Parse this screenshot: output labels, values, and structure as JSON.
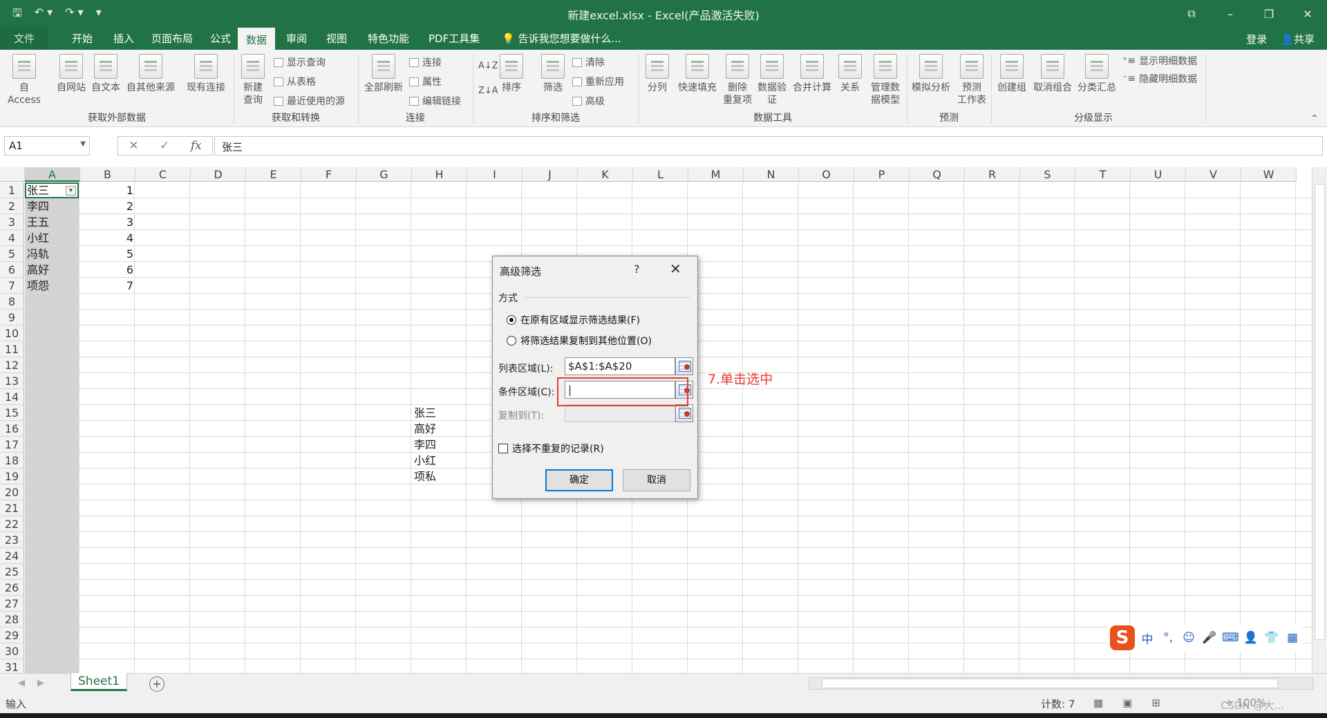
{
  "window": {
    "title": "新建excel.xlsx - Excel(产品激活失败)",
    "qat": [
      "save-icon",
      "undo-icon",
      "redo-icon",
      "customize-icon"
    ],
    "controls": [
      "⧉",
      "–",
      "❐",
      "✕"
    ]
  },
  "tabs": {
    "file": "文件",
    "items": [
      "开始",
      "插入",
      "页面布局",
      "公式",
      "数据",
      "审阅",
      "视图",
      "特色功能",
      "PDF工具集"
    ],
    "active": "数据",
    "tell_me": "告诉我您想要做什么...",
    "login": "登录",
    "share": "共享"
  },
  "ribbon": {
    "get_external": {
      "buttons": [
        "自 Access",
        "自网站",
        "自文本",
        "自其他来源",
        "现有连接"
      ],
      "label": "获取外部数据"
    },
    "get_transform": {
      "new_query": "新建\n查询",
      "small": [
        "显示查询",
        "从表格",
        "最近使用的源"
      ],
      "label": "获取和转换"
    },
    "connections": {
      "refresh_all": "全部刷新",
      "small": [
        "连接",
        "属性",
        "编辑链接"
      ],
      "label": "连接"
    },
    "sort_filter": {
      "sort": "排序",
      "filter": "筛选",
      "small": [
        "清除",
        "重新应用",
        "高级"
      ],
      "label": "排序和筛选"
    },
    "data_tools": {
      "buttons": [
        "分列",
        "快速填充",
        "删除\n重复项",
        "数据验\n证",
        "合并计算",
        "关系",
        "管理数\n据模型"
      ],
      "label": "数据工具"
    },
    "forecast": {
      "buttons": [
        "模拟分析",
        "预测\n工作表"
      ],
      "label": "预测"
    },
    "outline": {
      "buttons": [
        "创建组",
        "取消组合",
        "分类汇总"
      ],
      "small": [
        "显示明细数据",
        "隐藏明细数据"
      ],
      "label": "分级显示"
    }
  },
  "formula_bar": {
    "name_box": "A1",
    "fx": "fx",
    "cancel": "✕",
    "enter": "✓",
    "value": "张三"
  },
  "sheet": {
    "columns": [
      "A",
      "B",
      "C",
      "D",
      "E",
      "F",
      "G",
      "H",
      "I",
      "J",
      "K",
      "L",
      "M",
      "N",
      "O",
      "P",
      "Q",
      "R",
      "S",
      "T",
      "U",
      "V",
      "W"
    ],
    "rows": [
      "1",
      "2",
      "3",
      "4",
      "5",
      "6",
      "7",
      "8",
      "9",
      "10",
      "11",
      "12",
      "13",
      "14",
      "15",
      "16",
      "17",
      "18",
      "19",
      "20",
      "21",
      "22",
      "23",
      "24",
      "25",
      "26",
      "27",
      "28",
      "29",
      "30",
      "31"
    ],
    "col_a": [
      "张三",
      "李四",
      "王五",
      "小红",
      "冯轨",
      "高好",
      "项怨"
    ],
    "col_b": [
      "1",
      "2",
      "3",
      "4",
      "5",
      "6",
      "7"
    ],
    "col_h": [
      "张三",
      "高好",
      "李四",
      "小红",
      "项私"
    ],
    "tab": "Sheet1"
  },
  "dialog": {
    "title": "高级筛选",
    "help": "?",
    "close": "✕",
    "section": "方式",
    "radio1": "在原有区域显示筛选结果(F)",
    "radio2": "将筛选结果复制到其他位置(O)",
    "list_range_label": "列表区域(L):",
    "list_range_value": "$A$1:$A$20",
    "criteria_label": "条件区域(C):",
    "criteria_value": "|",
    "copy_to_label": "复制到(T):",
    "unique_label": "选择不重复的记录(R)",
    "ok": "确定",
    "cancel": "取消"
  },
  "annotation": "7.单击选中",
  "status": {
    "mode": "输入",
    "count": "计数: 7",
    "zoom": "+ 100%"
  },
  "ime": {
    "logo": "S",
    "items": [
      "中",
      "°,",
      "☺",
      "🎤",
      "⌨",
      "👤",
      "👕",
      "▦"
    ]
  },
  "watermark": "CSDN @大..."
}
